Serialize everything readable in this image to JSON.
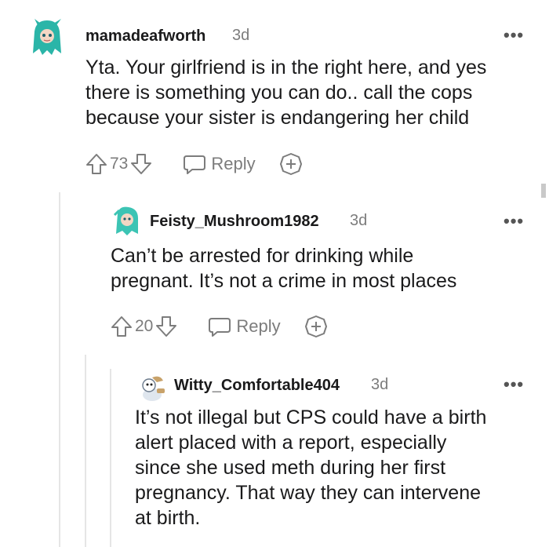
{
  "comments": [
    {
      "username": "mamadeafworth",
      "age": "3d",
      "more": "•••",
      "lines": [
        "Yta. Your girlfriend is in the right here, and yes",
        "there is something you can do.. call the cops",
        "because your sister is endangering her child"
      ],
      "votes": "73",
      "reply_label": "Reply",
      "avatar_color": "#2bb5a8"
    },
    {
      "username": "Feisty_Mushroom1982",
      "age": "3d",
      "more": "•••",
      "lines": [
        "Can’t be arrested for drinking while",
        "pregnant. It’s not a crime in most places"
      ],
      "votes": "20",
      "reply_label": "Reply",
      "avatar_color": "#3cc4b4"
    },
    {
      "username": "Witty_Comfortable404",
      "age": "3d",
      "more": "•••",
      "lines": [
        "It’s not illegal but CPS could have a birth",
        "alert placed with a report, especially",
        "since she used meth during her first",
        "pregnancy. That way they can intervene",
        "at birth."
      ],
      "avatar_color": "#c8a26a"
    }
  ],
  "icons": {
    "upvote": "upvote-arrow-icon",
    "downvote": "downvote-arrow-icon",
    "reply": "speech-bubble-icon",
    "award": "award-plus-icon"
  },
  "colors": {
    "text": "#1a1a1b",
    "meta": "#7c7c7c",
    "thread_line": "#e5e5e5"
  }
}
